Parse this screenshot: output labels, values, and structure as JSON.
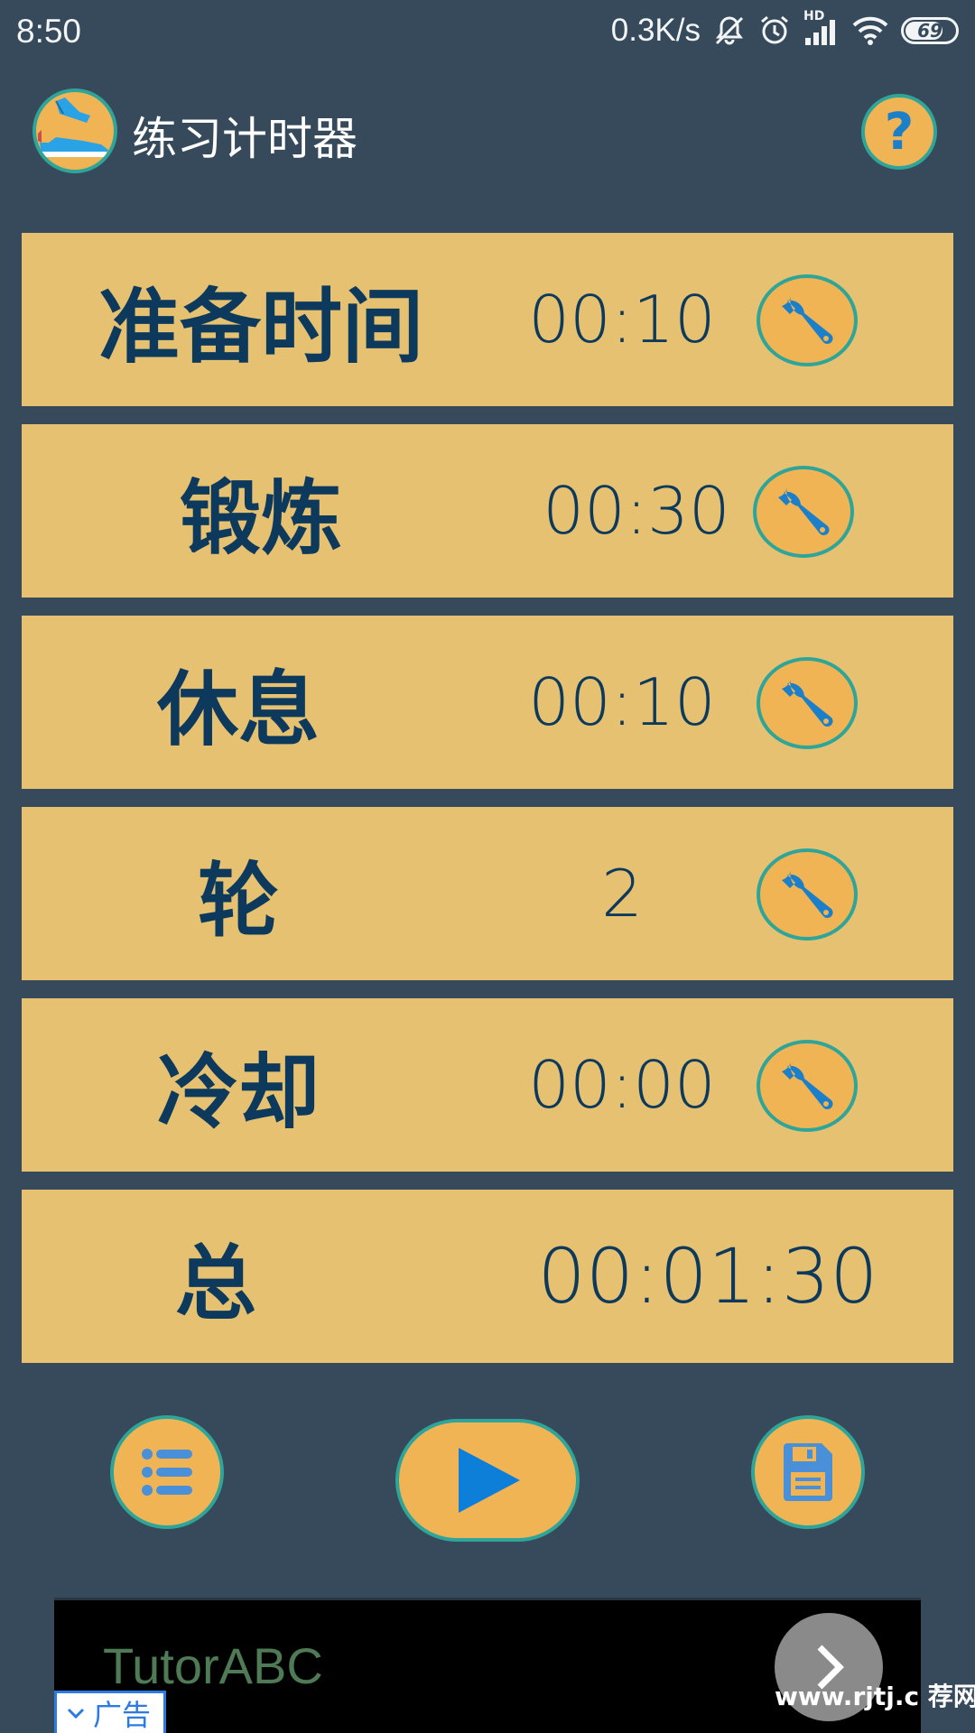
{
  "status_bar": {
    "time": "8:50",
    "net_speed": "0.3K/s",
    "hd_label": "HD",
    "battery": "69",
    "icons": [
      "mute-icon",
      "alarm-icon",
      "signal-icon",
      "wifi-icon",
      "battery-icon"
    ]
  },
  "app_bar": {
    "title": "练习计时器",
    "help_label": "?"
  },
  "rows": [
    {
      "label": "准备时间",
      "value": "00:10"
    },
    {
      "label": "锻炼",
      "value": "00:30"
    },
    {
      "label": "休息",
      "value": "00:10"
    },
    {
      "label": "轮",
      "value": "2"
    },
    {
      "label": "冷却",
      "value": "00:00"
    }
  ],
  "total": {
    "label": "总",
    "value": "00:01:30"
  },
  "controls": {
    "icons": [
      "list-icon",
      "play-icon",
      "save-icon"
    ]
  },
  "ad": {
    "text": "TutorABC",
    "tag": "广告"
  },
  "watermark": "www.rjtj.c   荐网",
  "colors": {
    "background": "#364a5b",
    "row": "#e5c171",
    "button": "#f0b454",
    "button_border": "#2fa59a",
    "text": "#0d3a5c",
    "icon_blue": "#1b7fc9"
  }
}
